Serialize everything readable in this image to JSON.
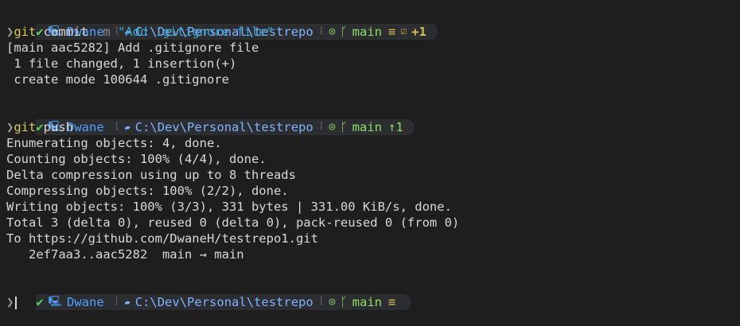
{
  "blocks": [
    {
      "prompt": {
        "status_icon": "check-icon",
        "user": "Dwane",
        "path": "C:\\Dev\\Personal\\testrepo",
        "branch": "main",
        "indicators": [
          "≡",
          "☑",
          "+1"
        ]
      },
      "command": {
        "cmd": "git",
        "rest": " commit ",
        "flag": "-m ",
        "arg": "\"Add .gitignore file\""
      },
      "output": [
        "[main aac5282] Add .gitignore file",
        " 1 file changed, 1 insertion(+)",
        " create mode 100644 .gitignore"
      ]
    },
    {
      "prompt": {
        "status_icon": "check-icon",
        "user": "Dwane",
        "path": "C:\\Dev\\Personal\\testrepo",
        "branch": "main",
        "indicators": [
          "↑1"
        ]
      },
      "command": {
        "cmd": "git",
        "rest": " push"
      },
      "output": [
        "Enumerating objects: 4, done.",
        "Counting objects: 100% (4/4), done.",
        "Delta compression using up to 8 threads",
        "Compressing objects: 100% (2/2), done.",
        "Writing objects: 100% (3/3), 331 bytes | 331.00 KiB/s, done.",
        "Total 3 (delta 0), reused 0 (delta 0), pack-reused 0 (from 0)",
        "To https://github.com/DwaneH/testrepo1.git",
        "   2ef7aa3..aac5282  main → main"
      ]
    },
    {
      "prompt": {
        "status_icon": "check-icon",
        "user": "Dwane",
        "path": "C:\\Dev\\Personal\\testrepo",
        "branch": "main",
        "indicators": [
          "≡"
        ]
      }
    }
  ],
  "icons": {
    "status": "check-icon",
    "host": "computer-icon",
    "separator": "vertical-dots-icon",
    "folder": "folder-icon",
    "remote": "github-icon",
    "branch": "git-branch-icon"
  },
  "colors": {
    "background": "#1e1e1e",
    "prompt_bg": "#2b2d30",
    "user": "#4ea1ff",
    "branch": "#8ee066",
    "command": "#d7c85a",
    "string": "#3aa7d6"
  }
}
